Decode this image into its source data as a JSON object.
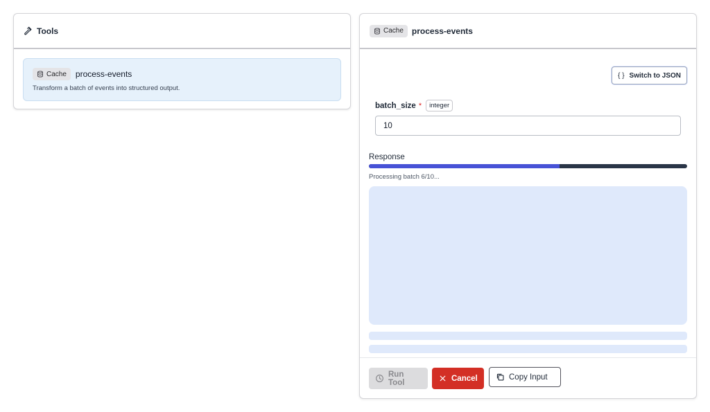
{
  "tools_panel": {
    "title": "Tools",
    "icon": "hammer-icon",
    "tool": {
      "badge": "Cache",
      "name": "process-events",
      "description": "Transform a batch of events into structured output."
    }
  },
  "detail_panel": {
    "badge": "Cache",
    "title": "process-events",
    "switch_json_braces": "{ }",
    "switch_json_label": "Switch to JSON",
    "field": {
      "name": "batch_size",
      "required_mark": "*",
      "type": "integer",
      "value": "10"
    },
    "response": {
      "label": "Response",
      "progress": 0.6,
      "status": "Processing batch 6/10..."
    },
    "actions": {
      "run_label": "Run Tool",
      "cancel_label": "Cancel",
      "copy_label": "Copy Input"
    }
  },
  "colors": {
    "progress_fill": "#4752d6",
    "progress_track": "#2a3547",
    "cancel": "#d32f25",
    "selected_card": "#e6f1fb",
    "skeleton": "#dfe9fb"
  }
}
